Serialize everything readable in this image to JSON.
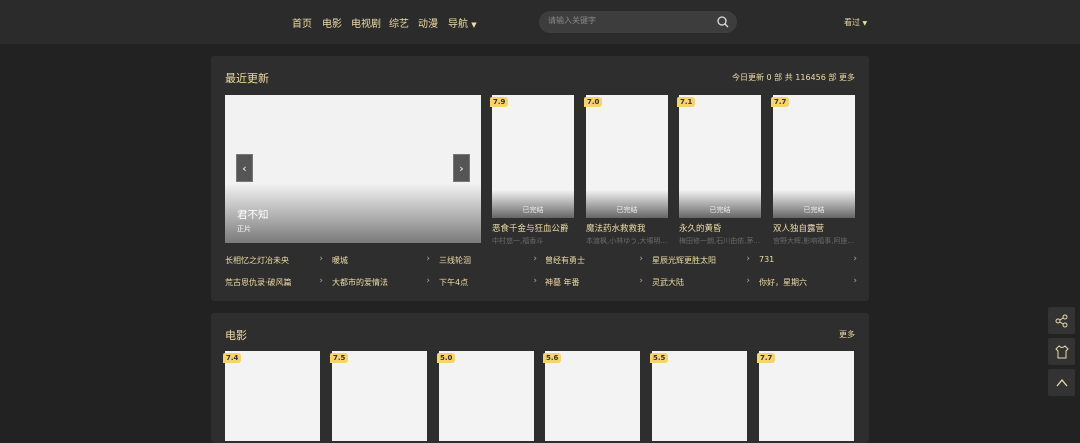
{
  "header": {
    "nav": [
      "首页",
      "电影",
      "电视剧",
      "综艺",
      "动漫",
      "导航"
    ],
    "search_placeholder": "请输入关键字",
    "history": "看过"
  },
  "recent": {
    "title": "最近更新",
    "stats": "今日更新 0 部  共 116456 部",
    "more": "更多",
    "carousel": {
      "title": "君不知",
      "subtitle": "正片"
    },
    "cards": [
      {
        "score": "7.9",
        "status": "已完结",
        "title": "恶食千金与狂血公爵",
        "sub": "中村悠一,福香斗"
      },
      {
        "score": "7.0",
        "status": "已完结",
        "title": "魔法药水救救我",
        "sub": "本渡枫,小林ゆう,大塚明..."
      },
      {
        "score": "7.1",
        "status": "已完结",
        "title": "永久的黄昏",
        "sub": "梅田修一朗,石川由依,茅..."
      },
      {
        "score": "7.7",
        "status": "已完结",
        "title": "双人独自露营",
        "sub": "宫野大辉,影响福事,阿座..."
      }
    ],
    "links": [
      [
        "长相忆之灯冶未央",
        "暖城",
        "三线轮洄",
        "曾经有勇士",
        "星辰光辉更胜太阳",
        "731"
      ],
      [
        "荒古恩仇录·破风篇",
        "大都市的爱情法",
        "下午4点",
        "神墓 年番",
        "灵武大陆",
        "你好，星期六"
      ]
    ]
  },
  "movies": {
    "title": "电影",
    "more": "更多",
    "scores": [
      "7.4",
      "7.5",
      "5.0",
      "5.6",
      "5.5",
      "7.7"
    ]
  },
  "colors": {
    "accent": "#eedba6",
    "badge": "#f7d36a",
    "bg": "#222222"
  }
}
